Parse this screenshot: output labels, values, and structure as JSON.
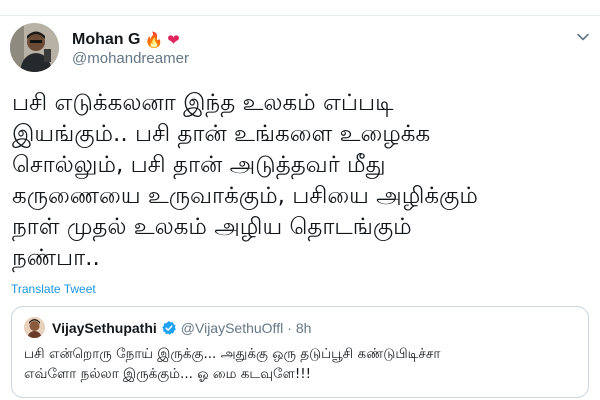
{
  "author": {
    "display_name": "Mohan G",
    "badges": [
      "🔥",
      "❤"
    ],
    "handle": "@mohandreamer"
  },
  "tweet": {
    "lines": [
      "பசி எடுக்கலனா இந்த உலகம் எப்படி",
      "இயங்கும்.. பசி தான் உங்களை உழைக்க",
      "சொல்லும், பசி தான் அடுத்தவர் மீது",
      "கருணையை உருவாக்கும், பசியை அழிக்கும்",
      "நாள் முதல் உலகம் அழிய தொடங்கும்",
      "நண்பா.."
    ],
    "translate_label": "Translate Tweet"
  },
  "quoted_tweet": {
    "display_name": "VijaySethupathi",
    "handle": "@VijaySethuOffl",
    "separator": "·",
    "time": "8h",
    "lines": [
      "பசி என்றொரு நோய் இருக்கு... அதுக்கு ஒரு தடுப்பூசி கண்டுபிடிச்சா",
      "எவ்ளோ நல்லா இருக்கும்... ஓ மை கடவுளே!!!"
    ]
  },
  "icons": {
    "caret": "chevron-down-icon",
    "verified": "verified-badge-icon"
  },
  "colors": {
    "link": "#1b95e0",
    "verified": "#1da1f2",
    "secondary_text": "#657786",
    "border": "#ccd6dd"
  }
}
